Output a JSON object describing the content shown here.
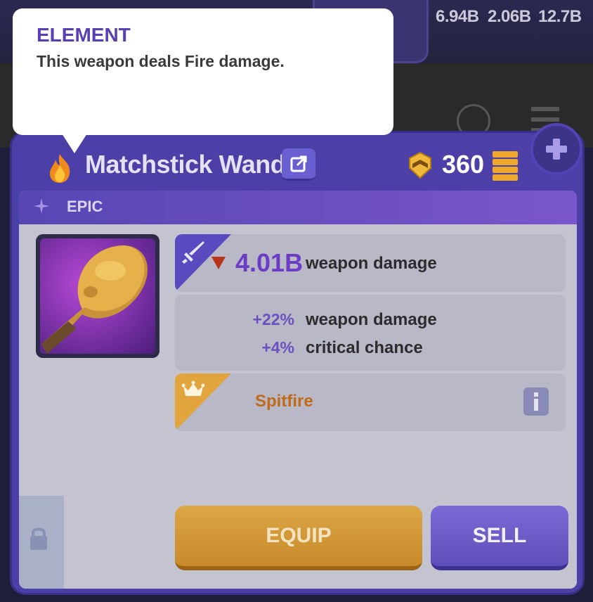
{
  "top_stats": [
    "6.94B",
    "2.06B",
    "12.7B"
  ],
  "tooltip": {
    "title": "ELEMENT",
    "body": "This weapon deals Fire damage."
  },
  "item": {
    "element_icon": "flame-icon",
    "name": "Matchstick Wand",
    "power": "360",
    "rarity": "EPIC",
    "rarity_color": "#6a4fc4",
    "main_stat": {
      "value": "4.01B",
      "label": "weapon damage",
      "trend": "down"
    },
    "modifiers": [
      {
        "value": "+22%",
        "label": "weapon damage"
      },
      {
        "value": "+4%",
        "label": "critical chance"
      }
    ],
    "set_name": "Spitfire"
  },
  "actions": {
    "equip_label": "EQUIP",
    "sell_label": "SELL"
  }
}
